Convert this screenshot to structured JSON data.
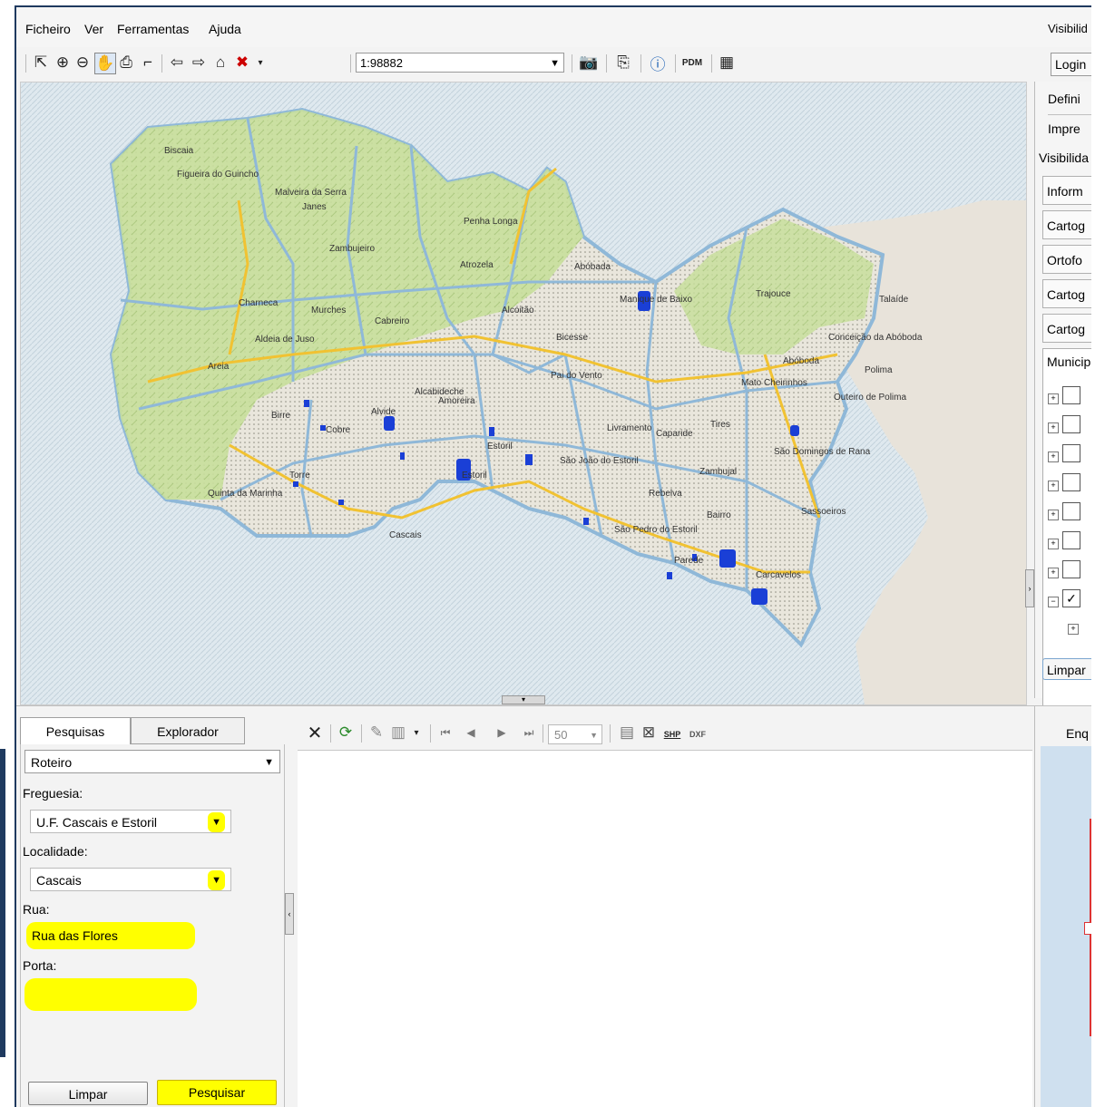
{
  "menu": [
    "Ficheiro",
    "Ver",
    "Ferramentas",
    "Ajuda"
  ],
  "top_right": {
    "visibility": "Visibilid",
    "login": "Login"
  },
  "toolbar": {
    "scale_value": "1:98882",
    "icons": [
      "select-arrow-icon",
      "zoom-in-icon",
      "zoom-out-icon",
      "pan-hand-icon",
      "print-icon",
      "measure-icon",
      "back-arrow-icon",
      "forward-arrow-icon",
      "home-icon",
      "clear-selection-icon",
      "camera-icon",
      "copy-icon",
      "help-icon",
      "pdm-icon",
      "table-window-icon"
    ],
    "pdm_label": "PDM"
  },
  "right_panel": {
    "definitions": "Defini",
    "print": "Impre",
    "visibility": "Visibilida",
    "layers": [
      "Inform",
      "Cartog",
      "Ortofo",
      "Cartog",
      "Cartog"
    ],
    "municipality": "Municip",
    "clear": "Limpar",
    "bottom_tab": "Enq"
  },
  "map": {
    "places": [
      "Biscaia",
      "Figueira do Guincho",
      "Malveira da Serra",
      "Janes",
      "Penha Longa",
      "Zambujeiro",
      "Atrozela",
      "Abóbada",
      "Manique de Baixo",
      "Trajouce",
      "Talaíde",
      "Charneca",
      "Murches",
      "Cabreiro",
      "Alcoitão",
      "Conceição da Abóboda",
      "Aldeia de Juso",
      "Areia",
      "Birre",
      "Alcabideche",
      "Amoreira",
      "Pai do Vento",
      "Bicesse",
      "Mato Cheirinhos",
      "Polima",
      "Outeiro de Polima",
      "Cobre",
      "Alvide",
      "Estoril",
      "Livramento",
      "Tires",
      "Caparide",
      "São Domingos de Rana",
      "Abóboda",
      "Quinta da Marinha",
      "Torre",
      "Estoril",
      "São João do Estoril",
      "Zambujal",
      "Cascais",
      "Rebelva",
      "Bairro",
      "São Pedro do Estoril",
      "Parede",
      "Carcavelos",
      "Sassoeiros"
    ]
  },
  "search": {
    "tabs": [
      "Pesquisas",
      "Explorador"
    ],
    "mode": "Roteiro",
    "freguesia_label": "Freguesia:",
    "freguesia_value": "U.F. Cascais e Estoril",
    "localidade_label": "Localidade:",
    "localidade_value": "Cascais",
    "rua_label": "Rua:",
    "rua_value": "Rua das Flores",
    "porta_label": "Porta:",
    "porta_value": "",
    "clear_button": "Limpar",
    "search_button": "Pesquisar"
  },
  "grid_toolbar": {
    "page_size": "50",
    "export_labels": [
      "SHP",
      "DXF"
    ]
  },
  "colors": {
    "highlight": "#ffff00",
    "map_green": "#cde3a3",
    "sea": "#c6dcec",
    "boundary": "#8fb8d8",
    "road": "#f1c232",
    "selection": "#1a3fd6"
  }
}
